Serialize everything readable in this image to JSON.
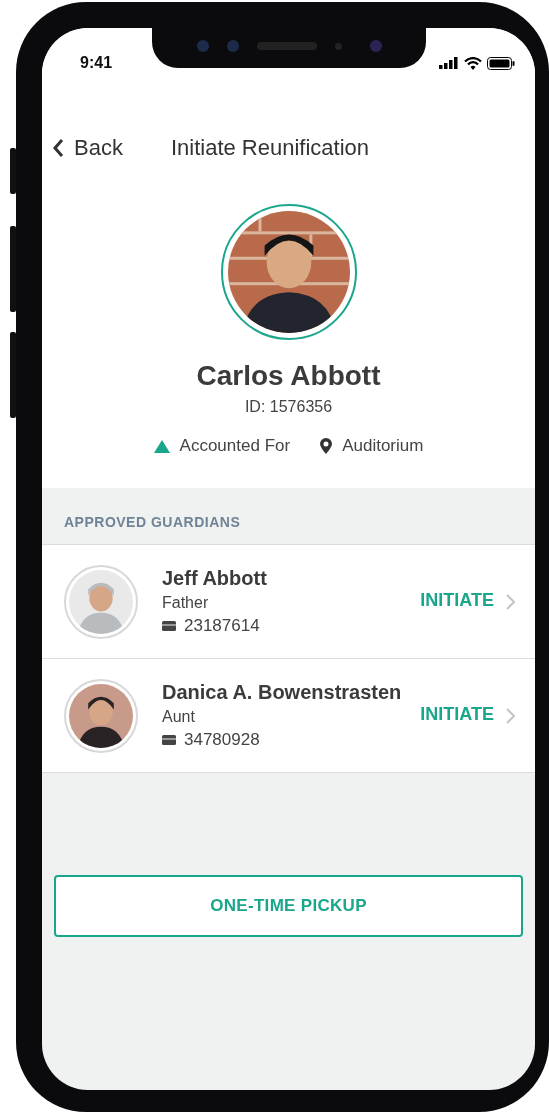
{
  "status_bar": {
    "time": "9:41"
  },
  "nav": {
    "back": "Back",
    "title": "Initiate Reunification"
  },
  "student": {
    "name": "Carlos Abbott",
    "id": "ID: 1576356",
    "status": "Accounted For",
    "location": "Auditorium"
  },
  "guardians_section": {
    "heading": "APPROVED GUARDIANS",
    "guardians": [
      {
        "name": "Jeff Abbott",
        "relation": "Father",
        "card_number": "23187614",
        "action": "INITIATE"
      },
      {
        "name": "Danica A. Bowenstrasten",
        "relation": "Aunt",
        "card_number": "34780928",
        "action": "INITIATE"
      }
    ]
  },
  "pickup_button": "ONE-TIME PICKUP"
}
